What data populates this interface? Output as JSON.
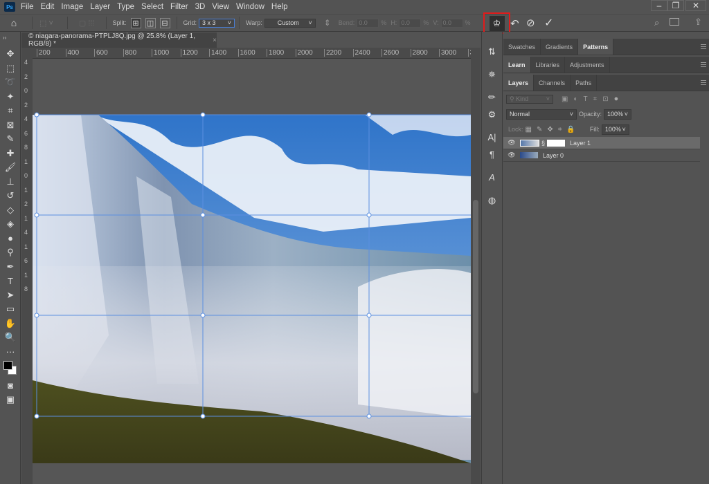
{
  "app": {
    "logo": "Ps",
    "menu": [
      "File",
      "Edit",
      "Image",
      "Layer",
      "Type",
      "Select",
      "Filter",
      "3D",
      "View",
      "Window",
      "Help"
    ],
    "window_controls": [
      "minimize",
      "restore",
      "close"
    ]
  },
  "options": {
    "split_label": "Split:",
    "grid_label": "Grid:",
    "grid_value": "3 x 3",
    "warp_label": "Warp:",
    "warp_value": "Custom",
    "bend_label": "Bend:",
    "bend_value": "0.0",
    "h_label": "H:",
    "h_value": "0.0",
    "v_label": "V:",
    "v_value": "0.0",
    "pct": "%"
  },
  "document": {
    "tab_title": "© niagara-panorama-PTPLJ8Q.jpg @ 25.8% (Layer 1, RGB/8) *",
    "close": "×"
  },
  "ruler": {
    "h_ticks": [
      "200",
      "400",
      "600",
      "800",
      "1000",
      "1200",
      "1400",
      "1600",
      "1800",
      "2000",
      "2200",
      "2400",
      "2600",
      "2800",
      "3000",
      "3"
    ],
    "v_ticks": [
      "4",
      "2",
      "0",
      "2",
      "4",
      "6",
      "8",
      "1",
      "0",
      "1",
      "2",
      "1",
      "4",
      "1",
      "6",
      "1",
      "8"
    ]
  },
  "panels": {
    "top_tabs": [
      "Swatches",
      "Gradients",
      "Patterns"
    ],
    "top_active": "Patterns",
    "mid_tabs": [
      "Learn",
      "Libraries",
      "Adjustments"
    ],
    "mid_active": "Learn",
    "layer_tabs": [
      "Layers",
      "Channels",
      "Paths"
    ],
    "layer_active": "Layers",
    "filter_placeholder": "Kind",
    "blend_mode": "Normal",
    "opacity_label": "Opacity:",
    "opacity_value": "100%",
    "lock_label": "Lock:",
    "fill_label": "Fill:",
    "fill_value": "100%",
    "layers": [
      {
        "name": "Layer 1",
        "selected": true
      },
      {
        "name": "Layer 0",
        "selected": false
      }
    ]
  },
  "colors": {
    "highlight": "#e21b1b",
    "grid": "#5b8fe0"
  }
}
